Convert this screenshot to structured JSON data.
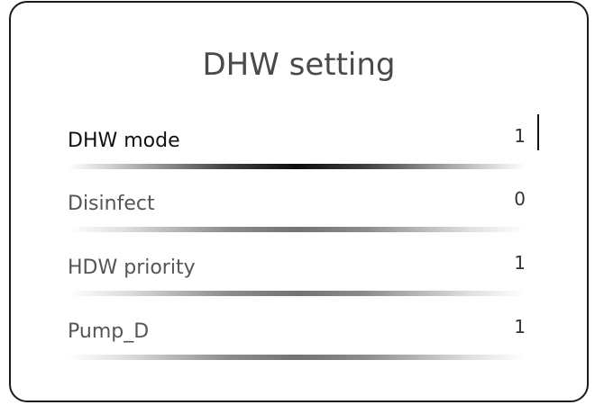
{
  "screen": {
    "title": "DHW setting"
  },
  "settings": [
    {
      "label": "DHW mode",
      "value": "1",
      "selected": true
    },
    {
      "label": "Disinfect",
      "value": "0",
      "selected": false
    },
    {
      "label": "HDW priority",
      "value": "1",
      "selected": false
    },
    {
      "label": "Pump_D",
      "value": "1",
      "selected": false
    }
  ]
}
